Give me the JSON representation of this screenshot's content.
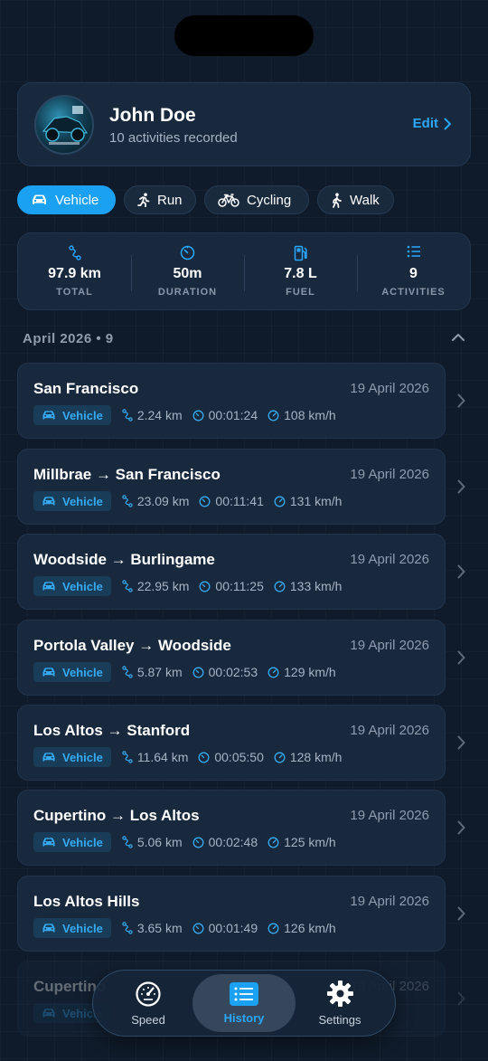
{
  "profile": {
    "name": "John Doe",
    "subtitle": "10 activities recorded",
    "edit_label": "Edit"
  },
  "filters": [
    {
      "label": "Vehicle",
      "icon": "car-icon",
      "active": true
    },
    {
      "label": "Run",
      "icon": "run-icon",
      "active": false
    },
    {
      "label": "Cycling",
      "icon": "bicycle-icon",
      "active": false
    },
    {
      "label": "Walk",
      "icon": "walk-icon",
      "active": false
    }
  ],
  "stats": [
    {
      "value": "97.9 km",
      "label": "TOTAL",
      "icon": "route-icon"
    },
    {
      "value": "50m",
      "label": "DURATION",
      "icon": "timer-icon"
    },
    {
      "value": "7.8 L",
      "label": "FUEL",
      "icon": "fuel-pump-icon"
    },
    {
      "value": "9",
      "label": "ACTIVITIES",
      "icon": "list-icon"
    }
  ],
  "section": {
    "title": "April 2026 • 9"
  },
  "activities": [
    {
      "title": "San Francisco",
      "date": "19 April 2026",
      "type": "Vehicle",
      "distance": "2.24 km",
      "duration": "00:01:24",
      "speed": "108 km/h"
    },
    {
      "title": "Millbrae → San Francisco",
      "date": "19 April 2026",
      "type": "Vehicle",
      "distance": "23.09 km",
      "duration": "00:11:41",
      "speed": "131 km/h"
    },
    {
      "title": "Woodside → Burlingame",
      "date": "19 April 2026",
      "type": "Vehicle",
      "distance": "22.95 km",
      "duration": "00:11:25",
      "speed": "133 km/h"
    },
    {
      "title": "Portola Valley → Woodside",
      "date": "19 April 2026",
      "type": "Vehicle",
      "distance": "5.87 km",
      "duration": "00:02:53",
      "speed": "129 km/h"
    },
    {
      "title": "Los Altos → Stanford",
      "date": "19 April 2026",
      "type": "Vehicle",
      "distance": "11.64 km",
      "duration": "00:05:50",
      "speed": "128 km/h"
    },
    {
      "title": "Cupertino → Los Altos",
      "date": "19 April 2026",
      "type": "Vehicle",
      "distance": "5.06 km",
      "duration": "00:02:48",
      "speed": "125 km/h"
    },
    {
      "title": "Los Altos Hills",
      "date": "19 April 2026",
      "type": "Vehicle",
      "distance": "3.65 km",
      "duration": "00:01:49",
      "speed": "126 km/h"
    },
    {
      "title": "Cupertino",
      "date": "19 April 2026",
      "type": "Vehicle",
      "distance": "",
      "duration": "",
      "speed": ""
    }
  ],
  "tabbar": [
    {
      "label": "Speed",
      "icon": "speedometer-icon",
      "active": false
    },
    {
      "label": "History",
      "icon": "list-icon",
      "active": true
    },
    {
      "label": "Settings",
      "icon": "gear-icon",
      "active": false
    }
  ],
  "colors": {
    "accent": "#1aa1f2",
    "background": "#0f1b2a",
    "card": "#18293d",
    "badge_bg": "#193c58"
  }
}
